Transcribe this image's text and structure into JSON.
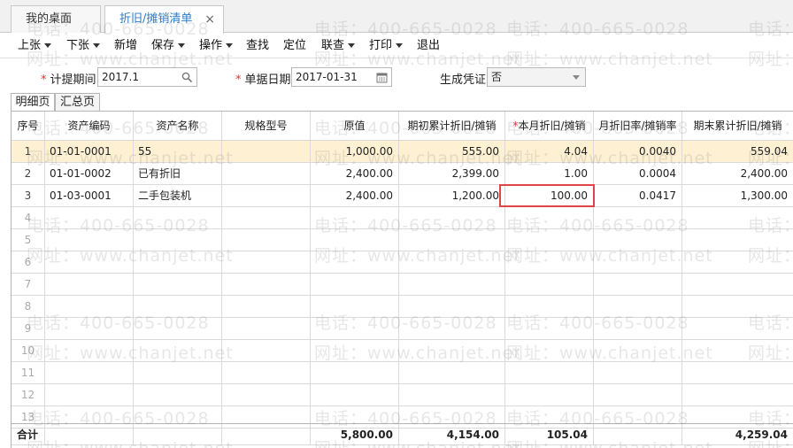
{
  "tabs": [
    {
      "label": "我的桌面",
      "active": false
    },
    {
      "label": "折旧/摊销清单",
      "active": true,
      "close": "×"
    }
  ],
  "toolbar": {
    "items": [
      {
        "label": "上张",
        "dropdown": true
      },
      {
        "label": "下张",
        "dropdown": true
      },
      {
        "label": "新增",
        "dropdown": false
      },
      {
        "label": "保存",
        "dropdown": true
      },
      {
        "label": "操作",
        "dropdown": true
      },
      {
        "label": "查找",
        "dropdown": false
      },
      {
        "label": "定位",
        "dropdown": false
      },
      {
        "label": "联查",
        "dropdown": true
      },
      {
        "label": "打印",
        "dropdown": true
      },
      {
        "label": "退出",
        "dropdown": false
      }
    ]
  },
  "form": {
    "period_label": "计提期间",
    "period_value": "2017.1",
    "date_label": "单据日期",
    "date_value": "2017-01-31",
    "voucher_label": "生成凭证",
    "voucher_value": "否",
    "required_mark": "*"
  },
  "subtabs": [
    {
      "label": "明细页",
      "active": true
    },
    {
      "label": "汇总页",
      "active": false
    }
  ],
  "table": {
    "columns": [
      "序号",
      "资产编码",
      "资产名称",
      "规格型号",
      "原值",
      "期初累计折旧/摊销",
      "本月折旧/摊销",
      "月折旧率/摊销率",
      "期末累计折旧/摊销"
    ],
    "required_column_mark": "*",
    "rows": [
      {
        "seq": "1",
        "code": "01-01-0001",
        "name": "55",
        "spec": "",
        "original": "1,000.00",
        "opening": "555.00",
        "monthly": "4.04",
        "rate": "0.0040",
        "closing": "559.04"
      },
      {
        "seq": "2",
        "code": "01-01-0002",
        "name": "已有折旧",
        "spec": "",
        "original": "2,400.00",
        "opening": "2,399.00",
        "monthly": "1.00",
        "rate": "0.0004",
        "closing": "2,400.00"
      },
      {
        "seq": "3",
        "code": "01-03-0001",
        "name": "二手包装机",
        "spec": "",
        "original": "2,400.00",
        "opening": "1,200.00",
        "monthly": "100.00",
        "rate": "0.0417",
        "closing": "1,300.00"
      }
    ],
    "empty_seq": [
      "4",
      "5",
      "6",
      "7",
      "8",
      "9",
      "10",
      "11",
      "12",
      "13"
    ],
    "footer": {
      "label": "合计",
      "original": "5,800.00",
      "opening": "4,154.00",
      "monthly": "105.04",
      "closing": "4,259.04"
    }
  },
  "watermark": {
    "phone": "电话：400-665-0028",
    "site": "网址：www.chanjet.net"
  }
}
